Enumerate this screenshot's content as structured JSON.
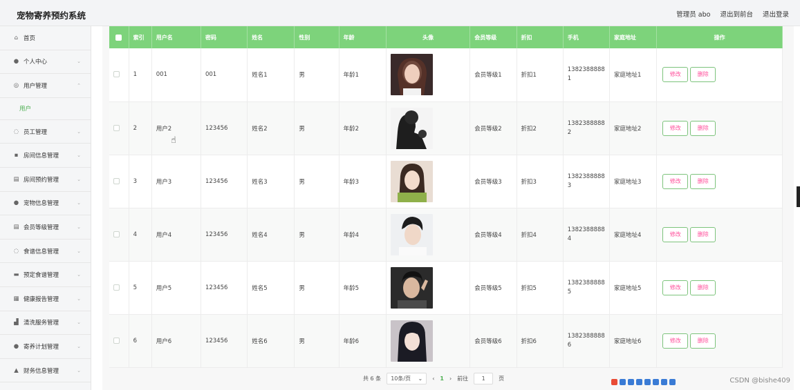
{
  "app": {
    "title": "宠物寄养预约系统"
  },
  "header": {
    "user": "管理员 abo",
    "front_link": "退出到前台",
    "logout": "退出登录"
  },
  "sidebar": {
    "items": [
      {
        "label": "首页",
        "icon": "home-icon",
        "glyph": "⌂",
        "chev": ""
      },
      {
        "label": "个人中心",
        "icon": "person-icon",
        "glyph": "●",
        "chev": "⌄"
      },
      {
        "label": "用户管理",
        "icon": "globe-icon",
        "glyph": "◎",
        "chev": "⌃"
      },
      {
        "label": "员工管理",
        "icon": "bulb-icon",
        "glyph": "◌",
        "chev": "⌄"
      },
      {
        "label": "房间信息管理",
        "icon": "doc-icon",
        "glyph": "▪",
        "chev": "⌄"
      },
      {
        "label": "房间预约管理",
        "icon": "clipboard-icon",
        "glyph": "▤",
        "chev": "⌄"
      },
      {
        "label": "宠物信息管理",
        "icon": "person-icon",
        "glyph": "●",
        "chev": "⌄"
      },
      {
        "label": "会员等级管理",
        "icon": "clipboard-icon",
        "glyph": "▤",
        "chev": "⌄"
      },
      {
        "label": "食谱信息管理",
        "icon": "mic-icon",
        "glyph": "◌",
        "chev": "⌄"
      },
      {
        "label": "预定食谱管理",
        "icon": "card-icon",
        "glyph": "▬",
        "chev": "⌄"
      },
      {
        "label": "健康报告管理",
        "icon": "grid-icon",
        "glyph": "▦",
        "chev": "⌄"
      },
      {
        "label": "清洗服务管理",
        "icon": "chart-icon",
        "glyph": "▟",
        "chev": "⌄"
      },
      {
        "label": "寄养计划管理",
        "icon": "person-icon",
        "glyph": "●",
        "chev": "⌄"
      },
      {
        "label": "财务信息管理",
        "icon": "bank-icon",
        "glyph": "▲",
        "chev": "⌄"
      }
    ],
    "sub_item": "用户"
  },
  "table": {
    "columns": [
      "索引",
      "用户名",
      "密码",
      "姓名",
      "性别",
      "年龄",
      "头像",
      "会员等级",
      "折扣",
      "手机",
      "家庭地址",
      "操作"
    ],
    "rows": [
      {
        "index": "1",
        "username": "001",
        "password": "001",
        "name": "姓名1",
        "gender": "男",
        "age": "年龄1",
        "level": "会员等级1",
        "discount": "折扣1",
        "phone": "13823888881",
        "address": "家庭地址1"
      },
      {
        "index": "2",
        "username": "用户2",
        "password": "123456",
        "name": "姓名2",
        "gender": "男",
        "age": "年龄2",
        "level": "会员等级2",
        "discount": "折扣2",
        "phone": "13823888882",
        "address": "家庭地址2"
      },
      {
        "index": "3",
        "username": "用户3",
        "password": "123456",
        "name": "姓名3",
        "gender": "男",
        "age": "年龄3",
        "level": "会员等级3",
        "discount": "折扣3",
        "phone": "13823888883",
        "address": "家庭地址3"
      },
      {
        "index": "4",
        "username": "用户4",
        "password": "123456",
        "name": "姓名4",
        "gender": "男",
        "age": "年龄4",
        "level": "会员等级4",
        "discount": "折扣4",
        "phone": "13823888884",
        "address": "家庭地址4"
      },
      {
        "index": "5",
        "username": "用户5",
        "password": "123456",
        "name": "姓名5",
        "gender": "男",
        "age": "年龄5",
        "level": "会员等级5",
        "discount": "折扣5",
        "phone": "13823888885",
        "address": "家庭地址5"
      },
      {
        "index": "6",
        "username": "用户6",
        "password": "123456",
        "name": "姓名6",
        "gender": "男",
        "age": "年龄6",
        "level": "会员等级6",
        "discount": "折扣6",
        "phone": "13823888886",
        "address": "家庭地址6"
      }
    ],
    "edit_label": "修改",
    "delete_label": "删除"
  },
  "pager": {
    "total": "共 6 条",
    "page_size": "10条/页",
    "current": "1",
    "goto": "前往",
    "goto_value": "1",
    "page_suffix": "页",
    "prev": "‹",
    "next": "›"
  },
  "watermark": "CSDN @bishe409",
  "colors": {
    "header_green": "#7dd37b",
    "accent": "#4caf50",
    "button_text": "#ff4d9a"
  }
}
